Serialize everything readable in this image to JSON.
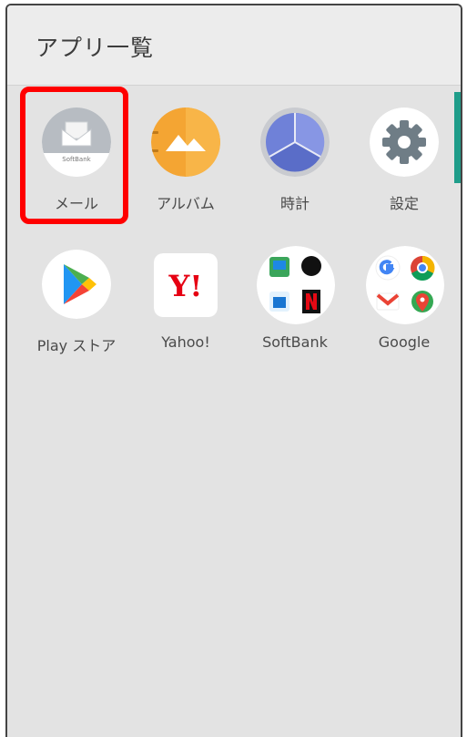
{
  "header": {
    "title": "アプリ一覧"
  },
  "apps": [
    {
      "label": "メール",
      "name": "mail",
      "badge_text": "SoftBank"
    },
    {
      "label": "アルバム",
      "name": "album"
    },
    {
      "label": "時計",
      "name": "clock"
    },
    {
      "label": "設定",
      "name": "settings"
    },
    {
      "label": "Play ストア",
      "name": "play-store"
    },
    {
      "label": "Yahoo!",
      "name": "yahoo",
      "logo_text": "Y!"
    },
    {
      "label": "SoftBank",
      "name": "softbank"
    },
    {
      "label": "Google",
      "name": "google"
    }
  ],
  "colors": {
    "highlight": "#ff0000",
    "accent": "#1f9d8a",
    "background": "#e3e3e3"
  }
}
